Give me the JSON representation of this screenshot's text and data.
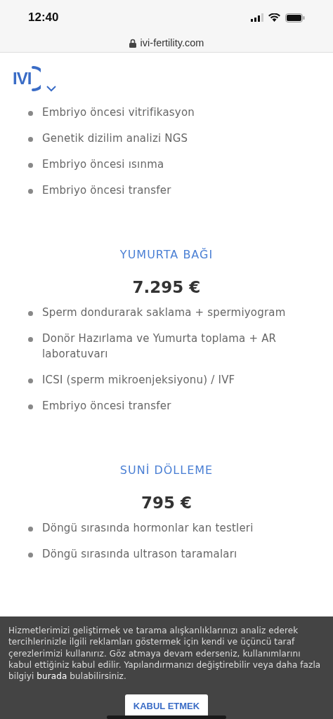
{
  "status_bar": {
    "time": "12:40"
  },
  "address_bar": {
    "url": "ivi-fertility.com"
  },
  "header": {
    "logo": "IVI"
  },
  "sections": [
    {
      "items": [
        "Embriyo öncesi vitrifikasyon",
        "Genetik dizilim analizi NGS",
        "Embriyo öncesi ısınma",
        "Embriyo öncesi transfer"
      ]
    },
    {
      "heading": "YUMURTA BAĞI",
      "price": "7.295 €",
      "items": [
        "Sperm dondurarak saklama + spermiyogram",
        "Donör Hazırlama ve Yumurta toplama + AR laboratuvarı",
        "ICSI (sperm mikroenjeksiyonu) / IVF",
        "Embriyo öncesi transfer"
      ]
    },
    {
      "heading": "SUNİ DÖLLEME",
      "price": "795 €",
      "items": [
        "Döngü sırasında hormonlar kan testleri",
        "Döngü sırasında ultrason taramaları"
      ]
    }
  ],
  "cookie_banner": {
    "text": "Hizmetlerimizi geliştirmek ve tarama alışkanlıklarınızı analiz ederek tercihlerinizle ilgili reklamları göstermek için kendi ve üçüncü taraf çerezlerimizi kullanırız. Göz atmaya devam ederseniz, kullanımlarını kabul ettiğiniz kabul edilir. Yapılandırmanızı değiştirebilir veya daha fazla bilgiyi **burada** bulabilirsiniz.",
    "button": "KABUL ETMEK"
  }
}
